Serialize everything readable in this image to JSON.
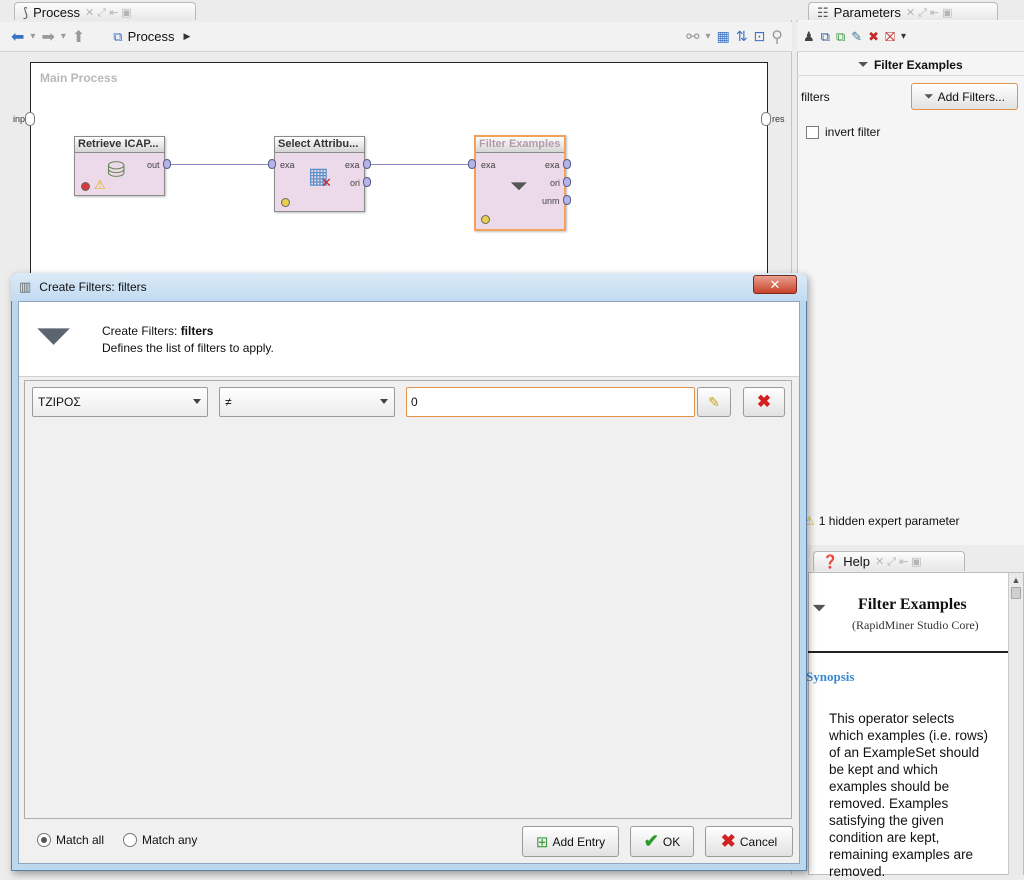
{
  "process_panel": {
    "tab_title": "Process",
    "breadcrumb": "Process",
    "canvas_title": "Main Process",
    "edge_ports": {
      "left": "inp",
      "right": "res"
    },
    "operators": [
      {
        "title": "Retrieve ICAP...",
        "ports_out": [
          "out"
        ]
      },
      {
        "title": "Select Attribu...",
        "ports_in": [
          "exa"
        ],
        "ports_out": [
          "exa",
          "ori"
        ]
      },
      {
        "title": "Filter Examples",
        "ports_in": [
          "exa"
        ],
        "ports_out": [
          "exa",
          "ori",
          "unm"
        ]
      }
    ]
  },
  "parameters_panel": {
    "tab_title": "Parameters",
    "operator_title": "Filter Examples",
    "filters_label": "filters",
    "add_filters_label": "Add Filters...",
    "invert_filter_label": "invert filter",
    "invert_filter_checked": false,
    "hidden_expert": "1 hidden expert parameter"
  },
  "help_panel": {
    "tab_title": "Help",
    "title": "Filter Examples",
    "subtitle": "(RapidMiner Studio Core)",
    "synopsis_heading": "Synopsis",
    "body": "This operator selects which examples (i.e. rows) of an ExampleSet should be kept and which examples should be removed. Examples satisfying the given condition are kept, remaining examples are removed."
  },
  "dialog": {
    "title": "Create Filters: filters",
    "header_prefix": "Create Filters: ",
    "header_bold": "filters",
    "description": "Defines the list of filters to apply.",
    "filter_row": {
      "attribute": "ΤΖΙΡΟΣ",
      "operator": "≠",
      "value": "0"
    },
    "match_all_label": "Match all",
    "match_any_label": "Match any",
    "match_selected": "all",
    "add_entry_label": "Add Entry",
    "ok_label": "OK",
    "cancel_label": "Cancel"
  },
  "colors": {
    "selection_orange": "#e2924a",
    "operator_fill": "#ecd9ea",
    "help_link_blue": "#3a89d0"
  }
}
